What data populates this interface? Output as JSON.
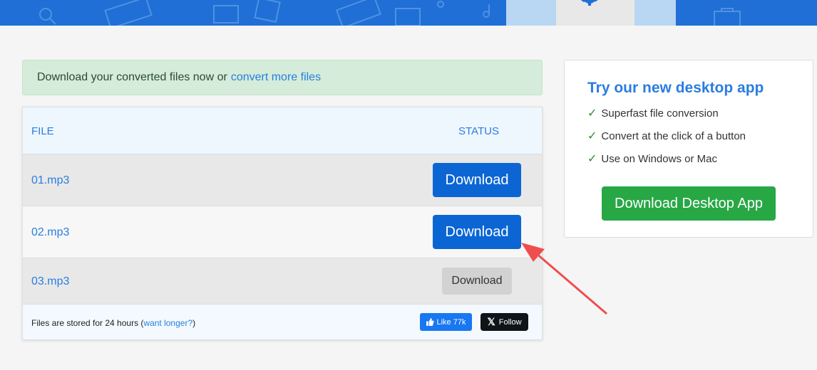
{
  "alert": {
    "text": "Download your converted files now or",
    "link": "convert more files"
  },
  "table": {
    "headers": {
      "file": "FILE",
      "status": "STATUS"
    },
    "rows": [
      {
        "file": "01.mp3",
        "action": "Download",
        "state": "ready"
      },
      {
        "file": "02.mp3",
        "action": "Download",
        "state": "ready"
      },
      {
        "file": "03.mp3",
        "action": "Download",
        "state": "pending"
      }
    ],
    "footer": {
      "note_prefix": "Files are stored for 24 hours (",
      "note_link": "want longer?",
      "note_suffix": ")",
      "like_label": "Like 77k",
      "follow_label": "Follow"
    }
  },
  "promo": {
    "title": "Try our new desktop app",
    "check_glyph": "✓",
    "features": [
      "Superfast file conversion",
      "Convert at the click of a button",
      "Use on Windows or Mac"
    ],
    "cta": "Download Desktop App"
  },
  "colors": {
    "brand_blue": "#0b66d4",
    "link_blue": "#2a7de1",
    "success_green": "#28a745",
    "alert_bg": "#d4ecd9",
    "annotation_red": "#f04e4e"
  },
  "icons": {
    "banner": [
      "search-icon",
      "gear-icon",
      "music-icon",
      "film-icon",
      "briefcase-icon"
    ],
    "like": "thumbs-up-icon",
    "follow": "x-logo-icon"
  }
}
